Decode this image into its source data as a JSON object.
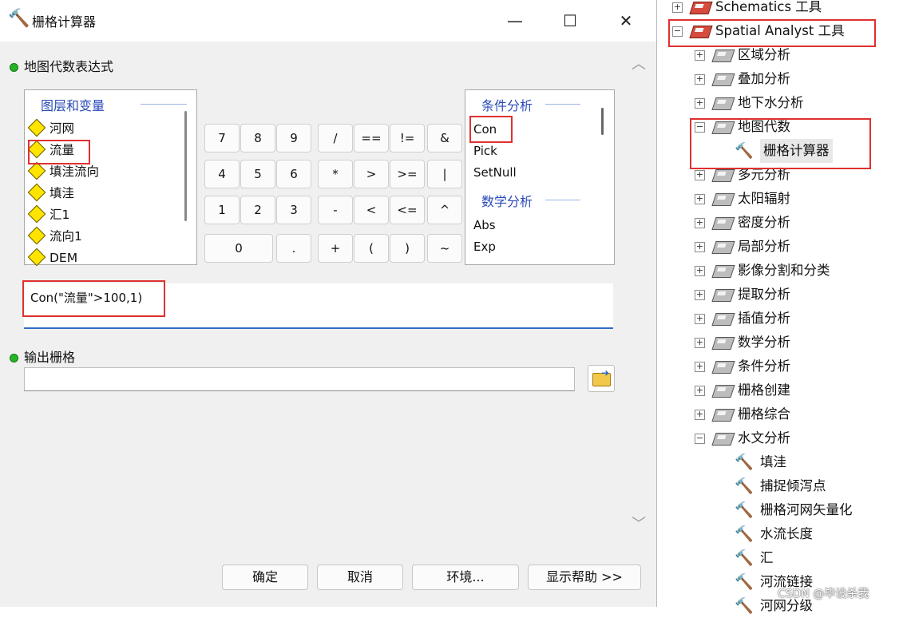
{
  "dialog": {
    "title": "栅格计算器",
    "window_buttons": {
      "minimize": "—",
      "maximize": "☐",
      "close": "✕"
    },
    "expression_label": "地图代数表达式",
    "layers": {
      "header": "图层和变量",
      "items": [
        "河网",
        "流量",
        "填洼流向",
        "填洼",
        "汇1",
        "流向1",
        "DEM"
      ]
    },
    "calculator": {
      "rows": [
        [
          "7",
          "8",
          "9",
          "/",
          "==",
          "!=",
          "&"
        ],
        [
          "4",
          "5",
          "6",
          "*",
          ">",
          ">=",
          "|"
        ],
        [
          "1",
          "2",
          "3",
          "-",
          "<",
          "<=",
          "^"
        ],
        [
          "0",
          ".",
          "+",
          "(",
          ")",
          "~"
        ]
      ]
    },
    "functions": {
      "group1": "条件分析",
      "group1_items": [
        "Con",
        "Pick",
        "SetNull"
      ],
      "group2": "数学分析",
      "group2_items": [
        "Abs",
        "Exp"
      ]
    },
    "expression": "Con(\"流量\">100,1)",
    "output_label": "输出栅格",
    "output_value": "",
    "buttons": {
      "ok": "确定",
      "cancel": "取消",
      "env": "环境...",
      "help": "显示帮助 >>"
    }
  },
  "toolbox_tree": [
    {
      "label": "Schematics 工具",
      "level": 0,
      "type": "toolbox",
      "state": "+"
    },
    {
      "label": "Spatial Analyst 工具",
      "level": 0,
      "type": "toolbox",
      "state": "-"
    },
    {
      "label": "区域分析",
      "level": 1,
      "type": "toolset",
      "state": "+"
    },
    {
      "label": "叠加分析",
      "level": 1,
      "type": "toolset",
      "state": "+"
    },
    {
      "label": "地下水分析",
      "level": 1,
      "type": "toolset",
      "state": "+"
    },
    {
      "label": "地图代数",
      "level": 1,
      "type": "toolset",
      "state": "-"
    },
    {
      "label": "栅格计算器",
      "level": 2,
      "type": "tool",
      "state": ""
    },
    {
      "label": "多元分析",
      "level": 1,
      "type": "toolset",
      "state": "+"
    },
    {
      "label": "太阳辐射",
      "level": 1,
      "type": "toolset",
      "state": "+"
    },
    {
      "label": "密度分析",
      "level": 1,
      "type": "toolset",
      "state": "+"
    },
    {
      "label": "局部分析",
      "level": 1,
      "type": "toolset",
      "state": "+"
    },
    {
      "label": "影像分割和分类",
      "level": 1,
      "type": "toolset",
      "state": "+"
    },
    {
      "label": "提取分析",
      "level": 1,
      "type": "toolset",
      "state": "+"
    },
    {
      "label": "插值分析",
      "level": 1,
      "type": "toolset",
      "state": "+"
    },
    {
      "label": "数学分析",
      "level": 1,
      "type": "toolset",
      "state": "+"
    },
    {
      "label": "条件分析",
      "level": 1,
      "type": "toolset",
      "state": "+"
    },
    {
      "label": "栅格创建",
      "level": 1,
      "type": "toolset",
      "state": "+"
    },
    {
      "label": "栅格综合",
      "level": 1,
      "type": "toolset",
      "state": "+"
    },
    {
      "label": "水文分析",
      "level": 1,
      "type": "toolset",
      "state": "-"
    },
    {
      "label": "填洼",
      "level": 2,
      "type": "tool",
      "state": ""
    },
    {
      "label": "捕捉倾泻点",
      "level": 2,
      "type": "tool",
      "state": ""
    },
    {
      "label": "栅格河网矢量化",
      "level": 2,
      "type": "tool",
      "state": ""
    },
    {
      "label": "水流长度",
      "level": 2,
      "type": "tool",
      "state": ""
    },
    {
      "label": "汇",
      "level": 2,
      "type": "tool",
      "state": ""
    },
    {
      "label": "河流链接",
      "level": 2,
      "type": "tool",
      "state": ""
    },
    {
      "label": "河网分级",
      "level": 2,
      "type": "tool",
      "state": ""
    }
  ],
  "watermark": "CSDN @毕设杀我"
}
